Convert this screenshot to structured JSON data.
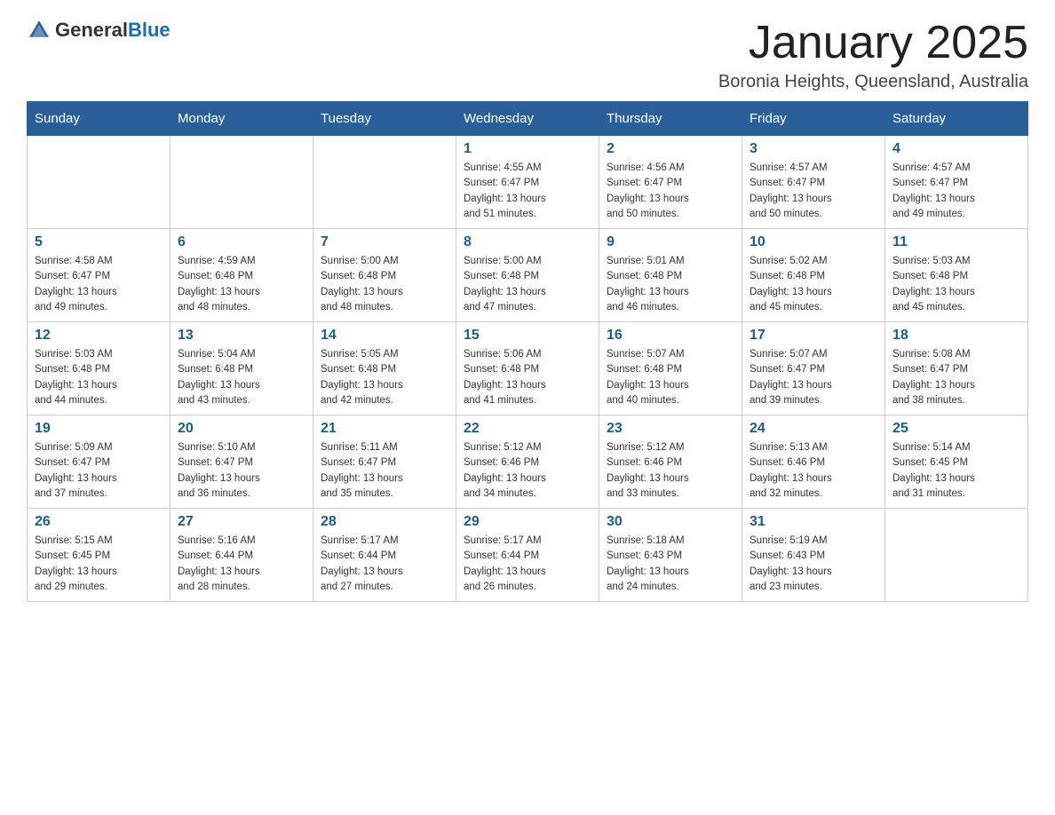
{
  "logo": {
    "general": "General",
    "blue": "Blue"
  },
  "title": "January 2025",
  "location": "Boronia Heights, Queensland, Australia",
  "days_of_week": [
    "Sunday",
    "Monday",
    "Tuesday",
    "Wednesday",
    "Thursday",
    "Friday",
    "Saturday"
  ],
  "weeks": [
    [
      {
        "day": "",
        "info": ""
      },
      {
        "day": "",
        "info": ""
      },
      {
        "day": "",
        "info": ""
      },
      {
        "day": "1",
        "info": "Sunrise: 4:55 AM\nSunset: 6:47 PM\nDaylight: 13 hours\nand 51 minutes."
      },
      {
        "day": "2",
        "info": "Sunrise: 4:56 AM\nSunset: 6:47 PM\nDaylight: 13 hours\nand 50 minutes."
      },
      {
        "day": "3",
        "info": "Sunrise: 4:57 AM\nSunset: 6:47 PM\nDaylight: 13 hours\nand 50 minutes."
      },
      {
        "day": "4",
        "info": "Sunrise: 4:57 AM\nSunset: 6:47 PM\nDaylight: 13 hours\nand 49 minutes."
      }
    ],
    [
      {
        "day": "5",
        "info": "Sunrise: 4:58 AM\nSunset: 6:47 PM\nDaylight: 13 hours\nand 49 minutes."
      },
      {
        "day": "6",
        "info": "Sunrise: 4:59 AM\nSunset: 6:48 PM\nDaylight: 13 hours\nand 48 minutes."
      },
      {
        "day": "7",
        "info": "Sunrise: 5:00 AM\nSunset: 6:48 PM\nDaylight: 13 hours\nand 48 minutes."
      },
      {
        "day": "8",
        "info": "Sunrise: 5:00 AM\nSunset: 6:48 PM\nDaylight: 13 hours\nand 47 minutes."
      },
      {
        "day": "9",
        "info": "Sunrise: 5:01 AM\nSunset: 6:48 PM\nDaylight: 13 hours\nand 46 minutes."
      },
      {
        "day": "10",
        "info": "Sunrise: 5:02 AM\nSunset: 6:48 PM\nDaylight: 13 hours\nand 45 minutes."
      },
      {
        "day": "11",
        "info": "Sunrise: 5:03 AM\nSunset: 6:48 PM\nDaylight: 13 hours\nand 45 minutes."
      }
    ],
    [
      {
        "day": "12",
        "info": "Sunrise: 5:03 AM\nSunset: 6:48 PM\nDaylight: 13 hours\nand 44 minutes."
      },
      {
        "day": "13",
        "info": "Sunrise: 5:04 AM\nSunset: 6:48 PM\nDaylight: 13 hours\nand 43 minutes."
      },
      {
        "day": "14",
        "info": "Sunrise: 5:05 AM\nSunset: 6:48 PM\nDaylight: 13 hours\nand 42 minutes."
      },
      {
        "day": "15",
        "info": "Sunrise: 5:06 AM\nSunset: 6:48 PM\nDaylight: 13 hours\nand 41 minutes."
      },
      {
        "day": "16",
        "info": "Sunrise: 5:07 AM\nSunset: 6:48 PM\nDaylight: 13 hours\nand 40 minutes."
      },
      {
        "day": "17",
        "info": "Sunrise: 5:07 AM\nSunset: 6:47 PM\nDaylight: 13 hours\nand 39 minutes."
      },
      {
        "day": "18",
        "info": "Sunrise: 5:08 AM\nSunset: 6:47 PM\nDaylight: 13 hours\nand 38 minutes."
      }
    ],
    [
      {
        "day": "19",
        "info": "Sunrise: 5:09 AM\nSunset: 6:47 PM\nDaylight: 13 hours\nand 37 minutes."
      },
      {
        "day": "20",
        "info": "Sunrise: 5:10 AM\nSunset: 6:47 PM\nDaylight: 13 hours\nand 36 minutes."
      },
      {
        "day": "21",
        "info": "Sunrise: 5:11 AM\nSunset: 6:47 PM\nDaylight: 13 hours\nand 35 minutes."
      },
      {
        "day": "22",
        "info": "Sunrise: 5:12 AM\nSunset: 6:46 PM\nDaylight: 13 hours\nand 34 minutes."
      },
      {
        "day": "23",
        "info": "Sunrise: 5:12 AM\nSunset: 6:46 PM\nDaylight: 13 hours\nand 33 minutes."
      },
      {
        "day": "24",
        "info": "Sunrise: 5:13 AM\nSunset: 6:46 PM\nDaylight: 13 hours\nand 32 minutes."
      },
      {
        "day": "25",
        "info": "Sunrise: 5:14 AM\nSunset: 6:45 PM\nDaylight: 13 hours\nand 31 minutes."
      }
    ],
    [
      {
        "day": "26",
        "info": "Sunrise: 5:15 AM\nSunset: 6:45 PM\nDaylight: 13 hours\nand 29 minutes."
      },
      {
        "day": "27",
        "info": "Sunrise: 5:16 AM\nSunset: 6:44 PM\nDaylight: 13 hours\nand 28 minutes."
      },
      {
        "day": "28",
        "info": "Sunrise: 5:17 AM\nSunset: 6:44 PM\nDaylight: 13 hours\nand 27 minutes."
      },
      {
        "day": "29",
        "info": "Sunrise: 5:17 AM\nSunset: 6:44 PM\nDaylight: 13 hours\nand 26 minutes."
      },
      {
        "day": "30",
        "info": "Sunrise: 5:18 AM\nSunset: 6:43 PM\nDaylight: 13 hours\nand 24 minutes."
      },
      {
        "day": "31",
        "info": "Sunrise: 5:19 AM\nSunset: 6:43 PM\nDaylight: 13 hours\nand 23 minutes."
      },
      {
        "day": "",
        "info": ""
      }
    ]
  ]
}
